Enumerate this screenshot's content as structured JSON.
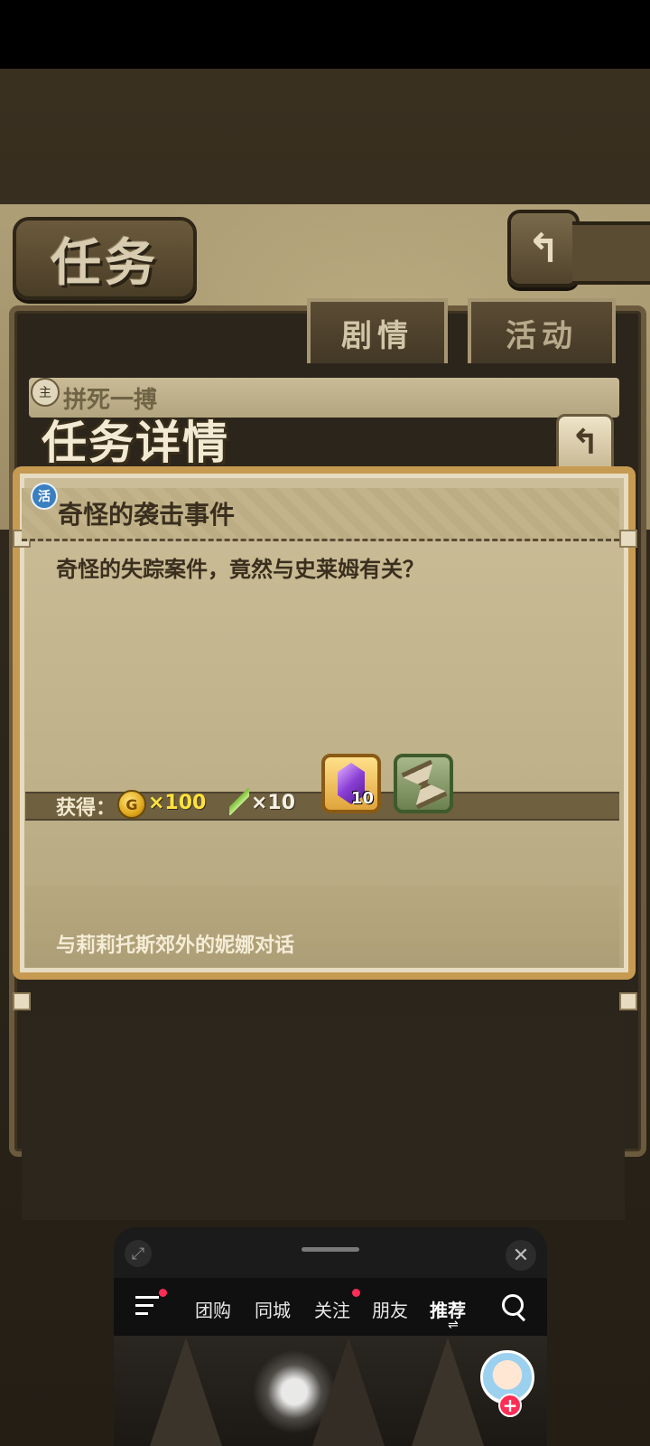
{
  "header": {
    "title": "任务",
    "back_icon": "back-arrow-icon"
  },
  "tabs": [
    {
      "label": "剧情",
      "active": true
    },
    {
      "label": "活动",
      "active": false
    }
  ],
  "quest_list": {
    "badge": "主",
    "first_item": "拼死一搏"
  },
  "detail": {
    "title": "任务详情",
    "back_icon": "back-arrow-icon",
    "task_badge": "活",
    "task_name": "奇怪的袭击事件",
    "description": "奇怪的失踪案件，竟然与史莱姆有关？",
    "reward_label": "获得：",
    "coin_symbol": "G",
    "coin_amount": "×100",
    "feather_amount": "×10",
    "items": [
      {
        "name": "purple-crystal",
        "count": "10"
      },
      {
        "name": "hourglass",
        "count": ""
      }
    ],
    "objective": "与莉莉托斯郊外的妮娜对话"
  },
  "overlay": {
    "tabs": [
      "团购",
      "同城",
      "关注",
      "朋友",
      "推荐"
    ],
    "active_tab": "推荐",
    "swap_glyph": "⇌",
    "close_glyph": "✕",
    "expand_glyph": "⤢",
    "plus_glyph": "+"
  },
  "colors": {
    "accent_orange": "#c79a52",
    "parchment": "#c2b38a",
    "coin_text": "#ffe23c",
    "notification_dot": "#ff2d55"
  }
}
